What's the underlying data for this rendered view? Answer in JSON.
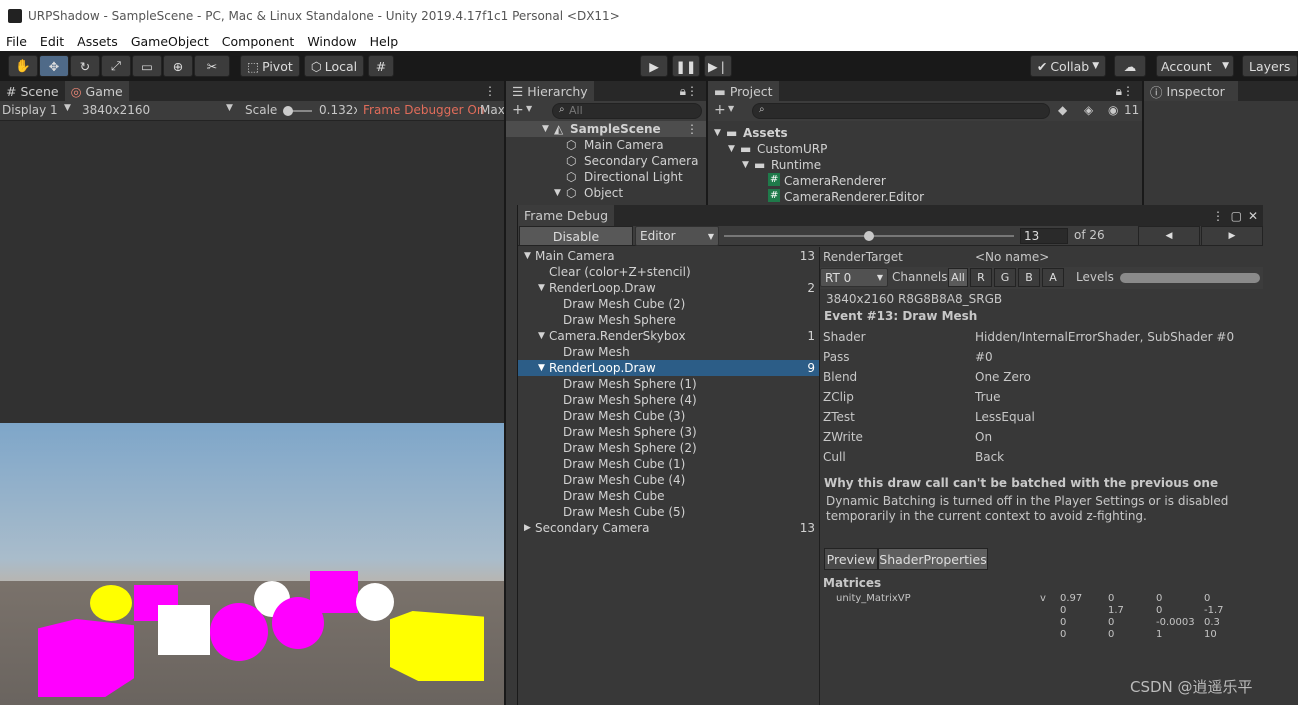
{
  "window": {
    "title": "URPShadow - SampleScene - PC, Mac & Linux Standalone - Unity 2019.4.17f1c1 Personal <DX11>"
  },
  "menu": [
    "File",
    "Edit",
    "Assets",
    "GameObject",
    "Component",
    "Window",
    "Help"
  ],
  "toolbar": {
    "pivot": "Pivot",
    "local": "Local",
    "collab": "Collab",
    "account": "Account",
    "layers": "Layers"
  },
  "game": {
    "tab_scene": "Scene",
    "tab_game": "Game",
    "display": "Display 1",
    "resolution": "3840x2160",
    "scale_label": "Scale",
    "scale_value": "0.132x",
    "frame_debugger": "Frame Debugger On",
    "max": "Max"
  },
  "hierarchy": {
    "tab": "Hierarchy",
    "search_placeholder": "All",
    "items": [
      {
        "label": "SampleScene"
      },
      {
        "label": "Main Camera"
      },
      {
        "label": "Secondary Camera"
      },
      {
        "label": "Directional Light"
      },
      {
        "label": "Object"
      }
    ]
  },
  "project": {
    "tab": "Project",
    "count": "11",
    "items": [
      {
        "label": "Assets"
      },
      {
        "label": "CustomURP"
      },
      {
        "label": "Runtime"
      },
      {
        "label": "CameraRenderer"
      },
      {
        "label": "CameraRenderer.Editor"
      }
    ]
  },
  "inspector": {
    "tab": "Inspector"
  },
  "frame_debug": {
    "tab": "Frame Debug",
    "disable": "Disable",
    "editor": "Editor",
    "event": "13",
    "of": "of 26",
    "slider_fraction": 0.5,
    "tree": [
      {
        "label": "Main Camera",
        "count": "13",
        "indent": 0,
        "arrow": "▼"
      },
      {
        "label": "Clear (color+Z+stencil)",
        "count": "",
        "indent": 1,
        "arrow": ""
      },
      {
        "label": "RenderLoop.Draw",
        "count": "2",
        "indent": 1,
        "arrow": "▼"
      },
      {
        "label": "Draw Mesh Cube (2)",
        "count": "",
        "indent": 2,
        "arrow": ""
      },
      {
        "label": "Draw Mesh Sphere",
        "count": "",
        "indent": 2,
        "arrow": ""
      },
      {
        "label": "Camera.RenderSkybox",
        "count": "1",
        "indent": 1,
        "arrow": "▼"
      },
      {
        "label": "Draw Mesh",
        "count": "",
        "indent": 2,
        "arrow": ""
      },
      {
        "label": "RenderLoop.Draw",
        "count": "9",
        "indent": 1,
        "arrow": "▼",
        "selected": true
      },
      {
        "label": "Draw Mesh Sphere (1)",
        "count": "",
        "indent": 2,
        "arrow": ""
      },
      {
        "label": "Draw Mesh Sphere (4)",
        "count": "",
        "indent": 2,
        "arrow": ""
      },
      {
        "label": "Draw Mesh Cube (3)",
        "count": "",
        "indent": 2,
        "arrow": ""
      },
      {
        "label": "Draw Mesh Sphere (3)",
        "count": "",
        "indent": 2,
        "arrow": ""
      },
      {
        "label": "Draw Mesh Sphere (2)",
        "count": "",
        "indent": 2,
        "arrow": ""
      },
      {
        "label": "Draw Mesh Cube (1)",
        "count": "",
        "indent": 2,
        "arrow": ""
      },
      {
        "label": "Draw Mesh Cube (4)",
        "count": "",
        "indent": 2,
        "arrow": ""
      },
      {
        "label": "Draw Mesh Cube",
        "count": "",
        "indent": 2,
        "arrow": ""
      },
      {
        "label": "Draw Mesh Cube (5)",
        "count": "",
        "indent": 2,
        "arrow": ""
      },
      {
        "label": "Secondary Camera",
        "count": "13",
        "indent": 0,
        "arrow": "▶"
      }
    ],
    "render_target_label": "RenderTarget",
    "render_target_value": "<No name>",
    "rt": "RT 0",
    "channels": "Channels",
    "ch_all": "All",
    "ch_r": "R",
    "ch_g": "G",
    "ch_b": "B",
    "ch_a": "A",
    "levels": "Levels",
    "format": "3840x2160 R8G8B8A8_SRGB",
    "event_title": "Event #13: Draw Mesh",
    "props": [
      {
        "k": "Shader",
        "v": "Hidden/InternalErrorShader, SubShader #0"
      },
      {
        "k": "Pass",
        "v": "#0"
      },
      {
        "k": "Blend",
        "v": "One Zero"
      },
      {
        "k": "ZClip",
        "v": "True"
      },
      {
        "k": "ZTest",
        "v": "LessEqual"
      },
      {
        "k": "ZWrite",
        "v": "On"
      },
      {
        "k": "Cull",
        "v": "Back"
      }
    ],
    "batch_title": "Why this draw call can't be batched with the previous one",
    "batch_line1": "Dynamic Batching is turned off in the Player Settings or is disabled",
    "batch_line2": "temporarily in the current context to avoid z-fighting.",
    "btn_preview": "Preview",
    "btn_shader": "ShaderProperties",
    "matrices_title": "Matrices",
    "matrix_name": "unity_MatrixVP",
    "matrix_v": "v",
    "matrix": [
      [
        "0.97",
        "0",
        "0",
        "0"
      ],
      [
        "0",
        "1.7",
        "0",
        "-1.7"
      ],
      [
        "0",
        "0",
        "-0.0003",
        "0.3"
      ],
      [
        "0",
        "0",
        "1",
        "10"
      ]
    ]
  },
  "watermark": "CSDN @逍遥乐平",
  "colors": {
    "accent": "#2c5d87",
    "magenta": "#ff00ff",
    "yellow": "#ffff00"
  }
}
